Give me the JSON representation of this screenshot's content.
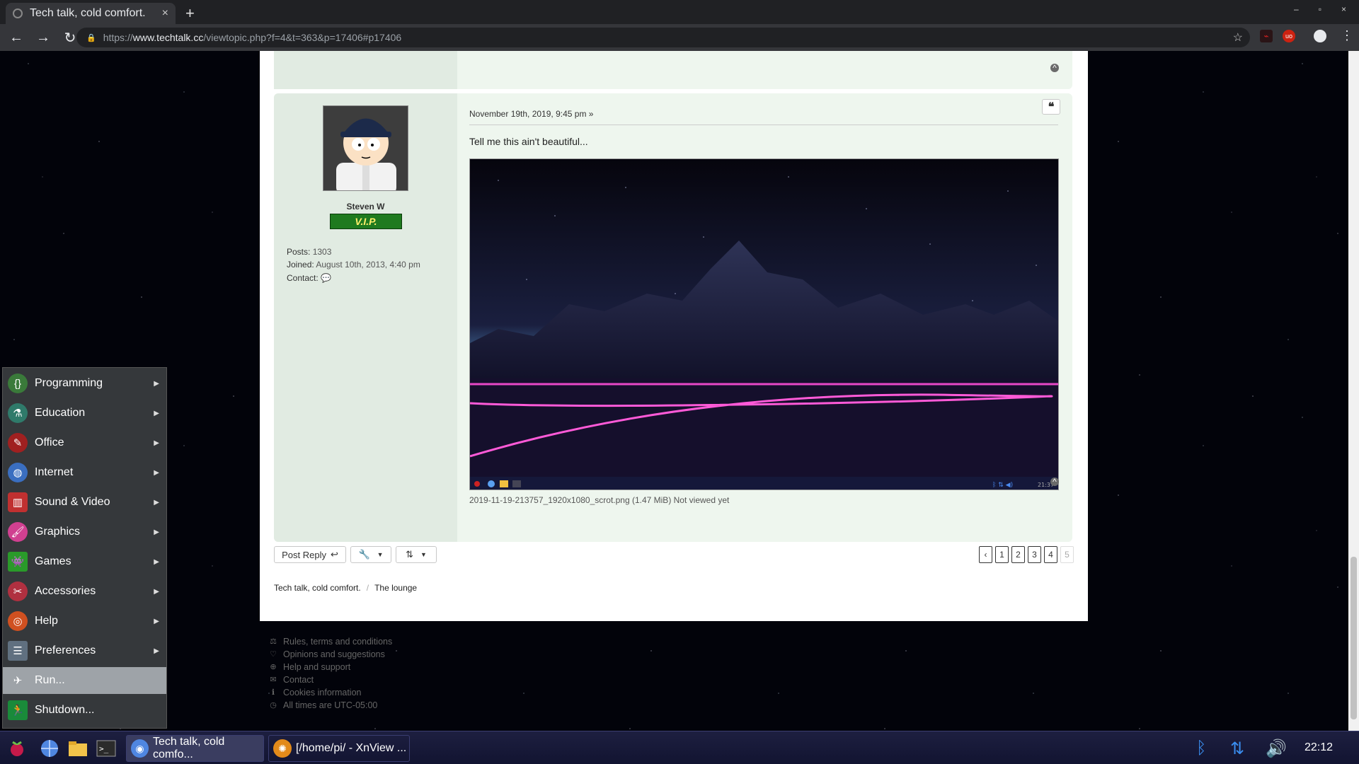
{
  "browser": {
    "tab_title": "Tech talk, cold comfort.",
    "tab_close": "×",
    "new_tab": "+",
    "url_scheme": "https://",
    "url_host": "www.techtalk.cc",
    "url_path": "/viewtopic.php?f=4&t=363&p=17406#p17406",
    "window_controls": [
      "–",
      "▫",
      "×"
    ]
  },
  "post": {
    "author": "Steven W",
    "rank_label": "V.I.P.",
    "posts_label": "Posts:",
    "posts_value": "1303",
    "joined_label": "Joined:",
    "joined_value": "August 10th, 2013, 4:40 pm",
    "contact_label": "Contact:",
    "date": "November 19th, 2019, 9:45 pm »",
    "text": "Tell me this ain't beautiful...",
    "attachment_caption": "2019-11-19-213757_1920x1080_scrot.png (1.47 MiB) Not viewed yet",
    "inner_clock": "21:37"
  },
  "actions": {
    "post_reply": "Post Reply",
    "pages": [
      "1",
      "2",
      "3",
      "4",
      "5"
    ],
    "current_page": "5"
  },
  "breadcrumbs": [
    "Tech talk, cold comfort.",
    "The lounge"
  ],
  "footer": [
    "Rules, terms and conditions",
    "Opinions and suggestions",
    "Help and support",
    "Contact",
    "Cookies information",
    "All times are UTC-05:00"
  ],
  "menu": {
    "items": [
      {
        "label": "Programming",
        "icon": "programming-icon",
        "color": "#3a7a3a"
      },
      {
        "label": "Education",
        "icon": "flask-icon",
        "color": "#2f7a6a"
      },
      {
        "label": "Office",
        "icon": "office-icon",
        "color": "#a02020"
      },
      {
        "label": "Internet",
        "icon": "globe-icon",
        "color": "#3a6ec0"
      },
      {
        "label": "Sound & Video",
        "icon": "popcorn-icon",
        "color": "#c03030"
      },
      {
        "label": "Graphics",
        "icon": "paintbrush-icon",
        "color": "#d04090"
      },
      {
        "label": "Games",
        "icon": "invader-icon",
        "color": "#2a9a2a"
      },
      {
        "label": "Accessories",
        "icon": "knife-icon",
        "color": "#b03040"
      },
      {
        "label": "Help",
        "icon": "lifebuoy-icon",
        "color": "#d05020"
      },
      {
        "label": "Preferences",
        "icon": "preferences-icon",
        "color": "#607080"
      },
      {
        "label": "Run...",
        "icon": "paper-plane-icon",
        "color": "#9ea3a8"
      },
      {
        "label": "Shutdown...",
        "icon": "exit-icon",
        "color": "#1a8a3a"
      }
    ]
  },
  "taskbar": {
    "task1": "Tech talk, cold comfo...",
    "task2": "[/home/pi/ - XnView ...",
    "clock": "22:12"
  },
  "colors": {
    "post_bg": "#eef6ee",
    "profile_bg": "#e1ebe2",
    "taskbar": "#1d1f40",
    "tray": "#3a8ef0"
  }
}
